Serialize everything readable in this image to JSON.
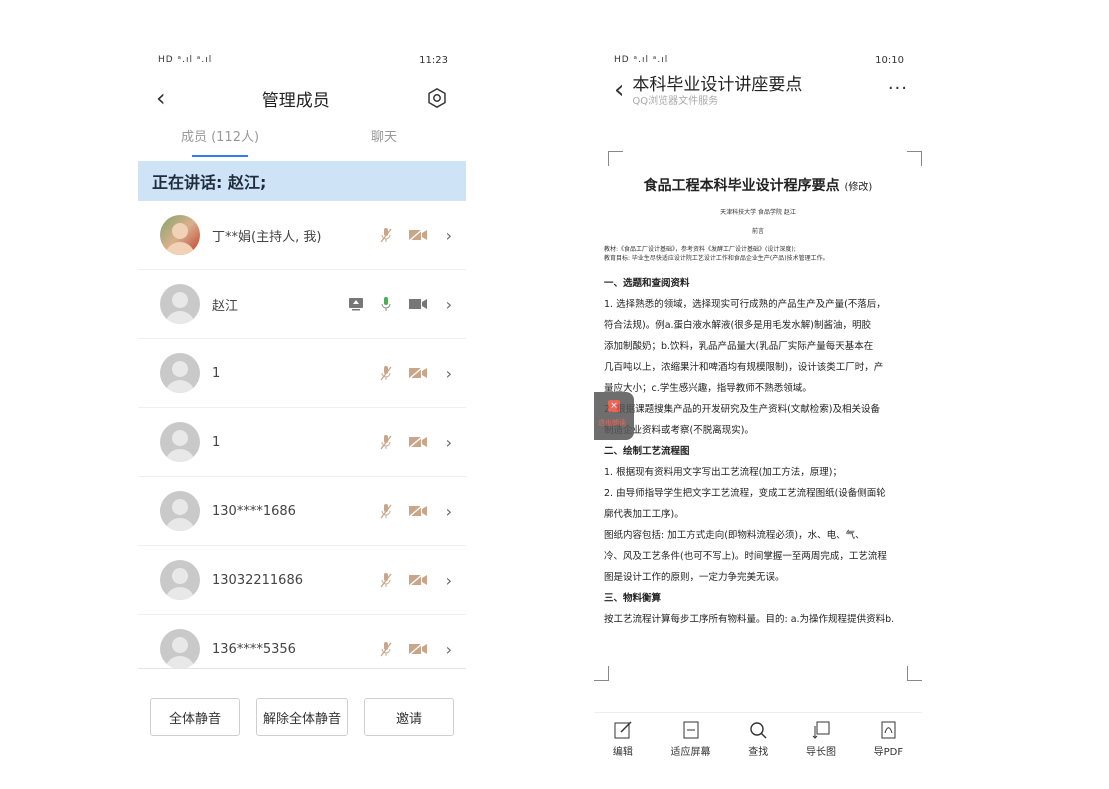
{
  "left": {
    "status": {
      "signal": "HD ᵃ.ıl ᵃ.ıl",
      "time": "11:23"
    },
    "header": {
      "title": "管理成员"
    },
    "tabs": [
      {
        "label": "成员 (112人)"
      },
      {
        "label": "聊天"
      }
    ],
    "speaking": "正在讲话: 赵江;",
    "members": [
      {
        "name": "丁**娟(主持人, 我)"
      },
      {
        "name": "赵江"
      },
      {
        "name": "1"
      },
      {
        "name": "1"
      },
      {
        "name": "130****1686"
      },
      {
        "name": "13032211686"
      },
      {
        "name": "136****5356"
      }
    ],
    "buttons": {
      "mute_all": "全体静音",
      "unmute_all": "解除全体静音",
      "invite": "邀请"
    }
  },
  "right": {
    "status": {
      "signal": "HD ᵃ.ıl ᵃ.ıl",
      "time": "10:10"
    },
    "header": {
      "title": "本科毕业设计讲座要点",
      "subtitle": "QQ浏览器文件服务",
      "more": "···"
    },
    "doc": {
      "title": "食品工程本科毕业设计程序要点",
      "title_suffix": "(修改)",
      "meta": "天津科技大学 食品学院 赵江",
      "preface": "前言",
      "note1": "教材:《食品工厂设计基础》，参考资料《发酵工厂设计基础》(设计深度);",
      "note2": "教育目标: 毕业生尽快适应设计院工艺设计工作和食品企业生产(产品)技术管理工作。",
      "lines": [
        "一、选题和查阅资料",
        "1. 选择熟悉的领域，选择现实可行成熟的产品生产及产量(不落后，",
        "符合法规)。例a.蛋白液水解液(很多是用毛发水解)制酱油，明胶",
        "添加制酸奶；b.饮料，乳品产品量大(乳品厂实际产量每天基本在",
        "几百吨以上，浓缩果汁和啤酒均有规模限制)，设计该类工厂时，产",
        "量应大小；c.学生感兴趣，指导教师不熟悉领域。",
        "2. 根据课题搜集产品的开发研究及生产资料(文献检索)及相关设备",
        "制造企业资料或考察(不脱离现实)。",
        "二、绘制工艺流程图",
        "1. 根据现有资料用文字写出工艺流程(加工方法，原理)；",
        "2. 由导师指导学生把文字工艺流程，变成工艺流程图纸(设备侧面轮",
        "廓代表加工工序)。",
        "图纸内容包括: 加工方式走向(即物料流程必须)，水、电、气、",
        "冷、风及工艺条件(也可不写上)。时间掌握一至两周完成，工艺流程",
        "图是设计工作的原则，一定力争完美无误。",
        "三、物料衡算",
        "按工艺流程计算每步工序所有物料量。目的: a.为操作规程提供资料b."
      ]
    },
    "float_widget": "退出朗读",
    "toolbar": [
      {
        "label": "编辑",
        "icon": "edit-icon"
      },
      {
        "label": "适应屏幕",
        "icon": "fit-screen-icon"
      },
      {
        "label": "查找",
        "icon": "search-icon"
      },
      {
        "label": "导长图",
        "icon": "export-image-icon"
      },
      {
        "label": "导PDF",
        "icon": "export-pdf-icon"
      }
    ]
  }
}
